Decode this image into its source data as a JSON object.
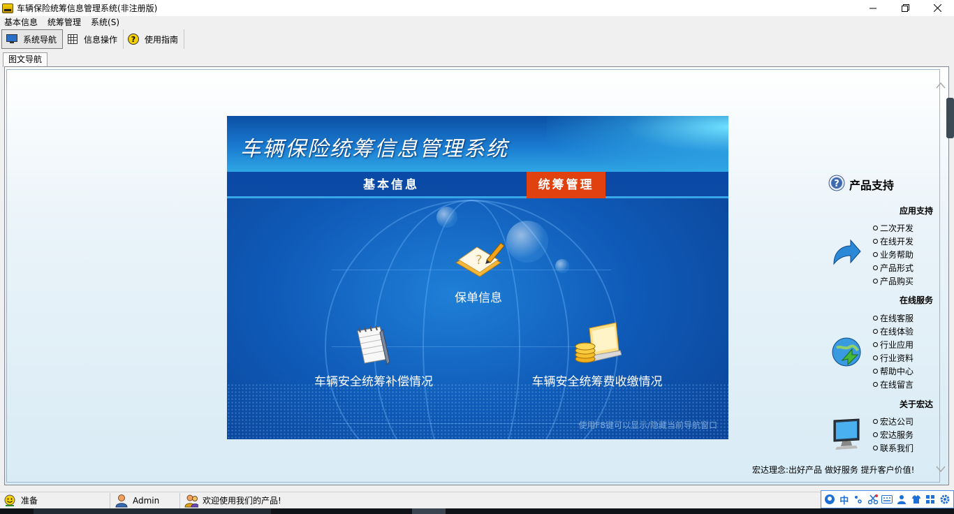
{
  "window": {
    "title": "车辆保险统筹信息管理系统(非注册版)"
  },
  "menu": [
    "基本信息",
    "统筹管理",
    "系统(S)"
  ],
  "toolbar": [
    "系统导航",
    "信息操作",
    "使用指南"
  ],
  "tab": {
    "label": "图文导航"
  },
  "banner": {
    "title": "车辆保险统筹信息管理系统",
    "nav": [
      "基本信息",
      "统筹管理"
    ],
    "features": [
      "保单信息",
      "车辆安全统筹补偿情况",
      "车辆安全统筹费收缴情况"
    ],
    "hint": "使用F8键可以显示/隐藏当前导航窗口"
  },
  "support": {
    "title": "产品支持",
    "sections": [
      {
        "title": "应用支持",
        "links": [
          "二次开发",
          "在线开发",
          "业务帮助",
          "产品形式",
          "产品购买"
        ]
      },
      {
        "title": "在线服务",
        "links": [
          "在线客服",
          "在线体验",
          "行业应用",
          "行业资料",
          "帮助中心",
          "在线留言"
        ]
      },
      {
        "title": "关于宏达",
        "links": [
          "宏达公司",
          "宏达服务",
          "联系我们"
        ]
      }
    ],
    "slogan": "宏达理念:出好产品 做好服务 提升客户价值!"
  },
  "status": [
    "准备",
    "Admin",
    "欢迎使用我们的产品!"
  ],
  "ime": {
    "lang": "中"
  },
  "colors": {
    "nav_active": "#e1400f",
    "banner_blue": "#0f5bb8"
  }
}
